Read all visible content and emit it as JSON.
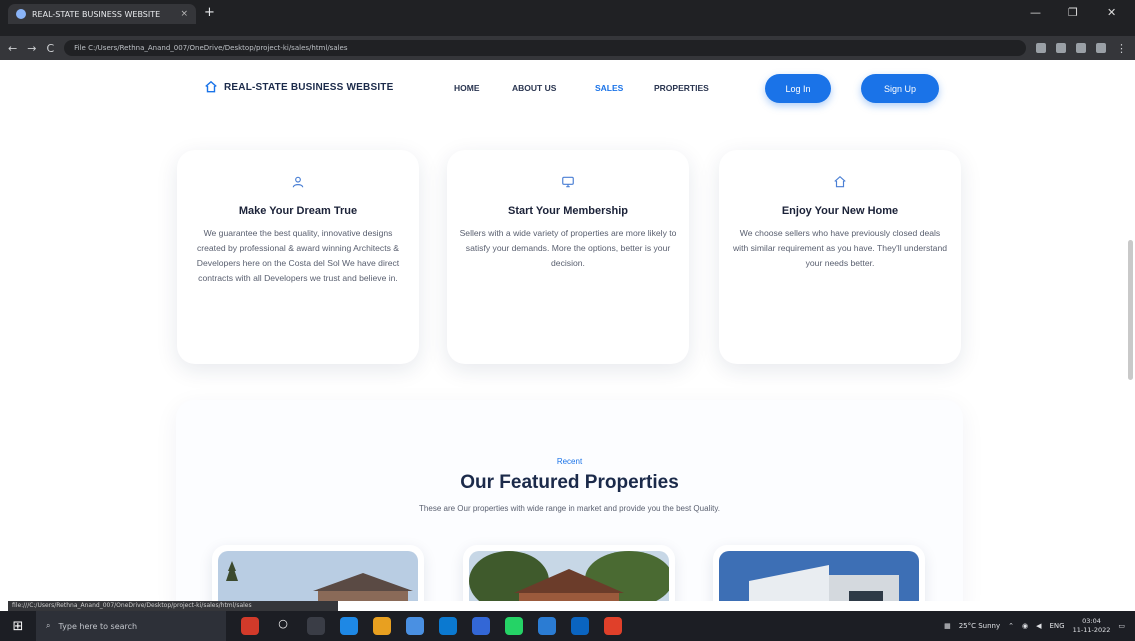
{
  "browser": {
    "tab_title": "REAL-STATE BUSINESS WEBSITE",
    "tab_close": "×",
    "new_tab": "+",
    "url": "File  C:/Users/Rethna_Anand_007/OneDrive/Desktop/project-ki/sales/html/sales",
    "nav_buttons": [
      "←",
      "→",
      "C"
    ],
    "window_controls": [
      "—",
      "❐",
      "✕"
    ],
    "status_url": "file:///C:/Users/Rethna_Anand_007/OneDrive/Desktop/project-ki/sales/html/sales"
  },
  "header": {
    "brand": "REAL-STATE BUSINESS WEBSITE",
    "nav": [
      {
        "label": "HOME"
      },
      {
        "label": "ABOUT US"
      },
      {
        "label": "SALES"
      },
      {
        "label": "PROPERTIES"
      }
    ],
    "login_label": "Log In",
    "signup_label": "Sign Up",
    "accent_color": "#1a73e8"
  },
  "features": [
    {
      "icon": "user-icon",
      "title": "Make Your Dream True",
      "text": "We guarantee the best quality, innovative designs created by professional & award winning Architects & Developers here on the Costa del Sol We have direct contracts with all Developers we trust and believe in."
    },
    {
      "icon": "monitor-icon",
      "title": "Start Your Membership",
      "text": "Sellers with a wide variety of properties are more likely to satisfy your demands. More the options, better is your decision."
    },
    {
      "icon": "home-icon",
      "title": "Enjoy Your New Home",
      "text": "We choose sellers who have previously closed deals with similar requirement as you have. They'll understand your needs better."
    }
  ],
  "featured": {
    "eyebrow": "Recent",
    "title": "Our Featured Properties",
    "subtitle": "These are Our properties with wide range in market and provide you the best Quality."
  },
  "taskbar": {
    "search_placeholder": "Type here to search",
    "weather": "25°C  Sunny",
    "lang": "ENG",
    "time": "03:04",
    "date": "11-11-2022"
  }
}
